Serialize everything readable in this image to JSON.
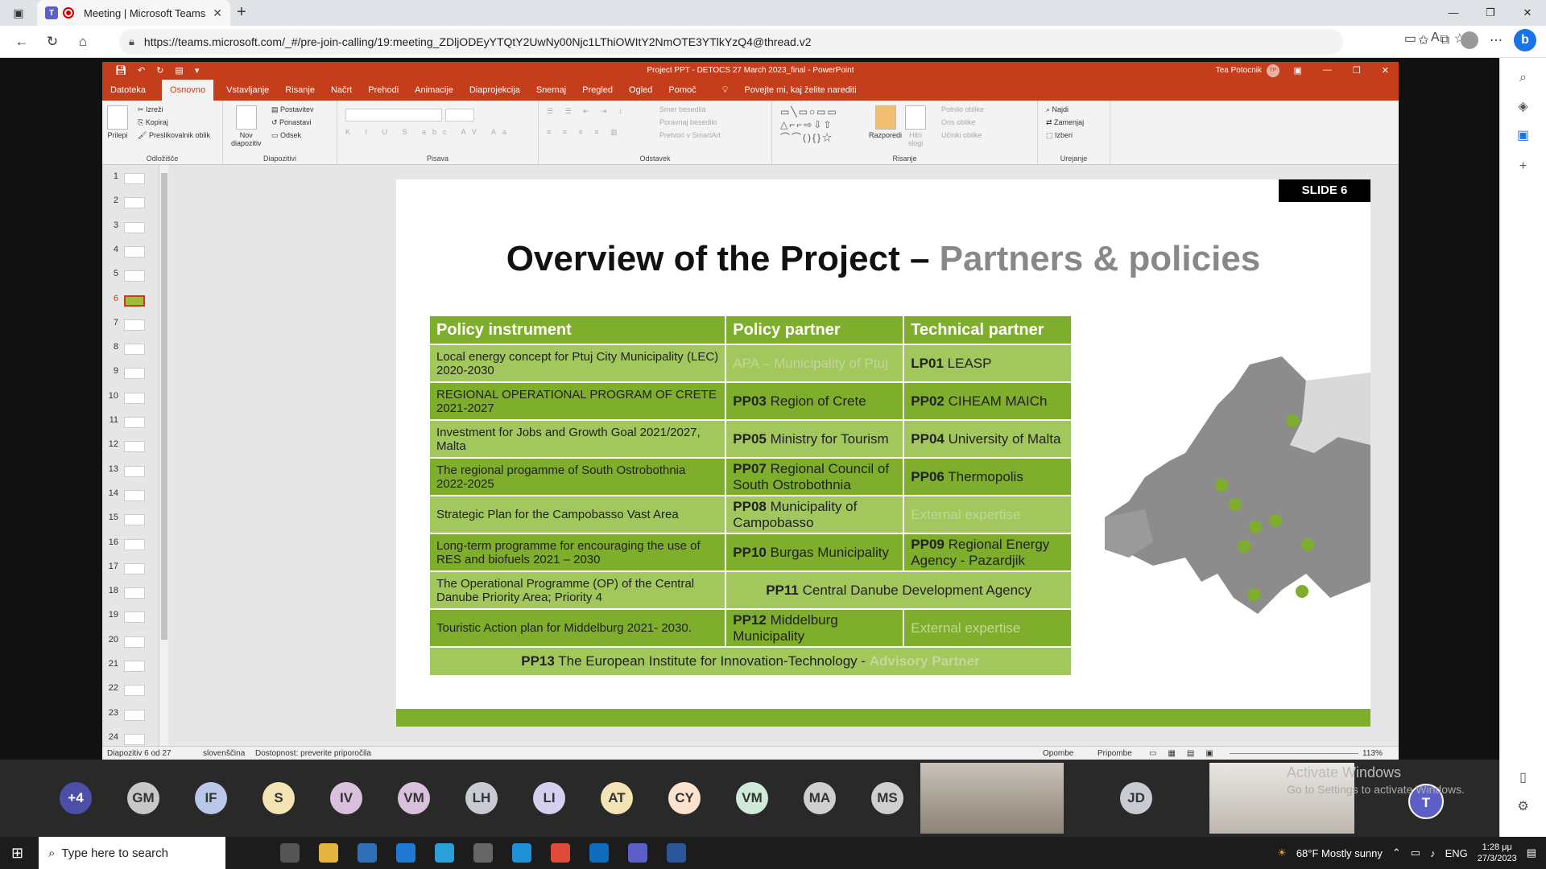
{
  "browser": {
    "tab_title": "Meeting | Microsoft Teams",
    "url": "https://teams.microsoft.com/_#/pre-join-calling/19:meeting_ZDljODEyYTQtY2UwNy00Njc1LThiOWItY2NmOTE3YTlkYzQ4@thread.v2"
  },
  "ppt": {
    "window_title": "Project PPT - DETOCS 27 March 2023_final  -  PowerPoint",
    "user_name": "Tea Potocnik",
    "user_initials": "TP",
    "tabs": [
      "Datoteka",
      "Osnovno",
      "Vstavljanje",
      "Risanje",
      "Načrt",
      "Prehodi",
      "Animacije",
      "Diaprojekcija",
      "Snemaj",
      "Pregled",
      "Ogled",
      "Pomoč"
    ],
    "active_tab": "Osnovno",
    "search": "Povejte mi, kaj želite narediti",
    "ribbon": {
      "paste": "Prilepi",
      "cut": "Izreži",
      "copy": "Kopiraj",
      "format_painter": "Preslikovalnik oblik",
      "clipboard": "Odložišče",
      "new_slide_1": "Nov",
      "new_slide_2": "diapozitiv",
      "layout": "Postavitev",
      "reset": "Ponastavi",
      "section": "Odsek",
      "slides": "Diapozitivi",
      "font": "Pisava",
      "text_direction": "Smer besedila",
      "align_text": "Poravnaj besedilo",
      "smartart": "Pretvori v SmartArt",
      "paragraph": "Odstavek",
      "arrange": "Razporedi",
      "quick_styles_1": "Hitri",
      "quick_styles_2": "slogi",
      "shape_fill": "Polnilo oblike",
      "shape_outline": "Oris oblike",
      "shape_effects": "Učinki oblike",
      "drawing": "Risanje",
      "find": "Najdi",
      "replace": "Zamenjaj",
      "select": "Izberi",
      "editing": "Urejanje"
    },
    "thumbnails": [
      "1",
      "2",
      "3",
      "4",
      "5",
      "6",
      "7",
      "8",
      "9",
      "10",
      "11",
      "12",
      "13",
      "14",
      "15",
      "16",
      "17",
      "18",
      "19",
      "20",
      "21",
      "22",
      "23",
      "24"
    ],
    "active_slide": "6",
    "status": {
      "slide": "Diapozitiv 6 od 27",
      "language": "slovenščina",
      "accessibility": "Dostopnost: preverite priporočila",
      "notes": "Opombe",
      "comments": "Pripombe",
      "zoom": "113%"
    }
  },
  "slide": {
    "tag": "SLIDE 6",
    "title_main": "Overview of the Project – ",
    "title_accent": "Partners & policies",
    "headers": [
      "Policy instrument",
      "Policy partner",
      "Technical partner"
    ],
    "rows": [
      {
        "instrument": "Local energy concept for Ptuj City Municipality (LEC) 2020-2030",
        "pcode": "",
        "pname": "APA – Municipality of Ptuj",
        "tcode": "LP01",
        "tname": "LEASP"
      },
      {
        "instrument": "REGIONAL OPERATIONAL PROGRAM OF CRETE 2021-2027",
        "pcode": "PP03",
        "pname": "Region of Crete",
        "tcode": "PP02",
        "tname": "CIHEAM MAICh"
      },
      {
        "instrument": "Investment for Jobs and Growth Goal 2021/2027, Malta",
        "pcode": "PP05",
        "pname": "Ministry for Tourism",
        "tcode": "PP04",
        "tname": "University of Malta"
      },
      {
        "instrument": "The regional progamme of South Ostrobothnia 2022-2025",
        "pcode": "PP07",
        "pname": "Regional Council of South Ostrobothnia",
        "tcode": "PP06",
        "tname": "Thermopolis"
      },
      {
        "instrument": "Strategic Plan for the Campobasso Vast Area",
        "pcode": "PP08",
        "pname": "Municipality of Campobasso",
        "tcode": "",
        "tname": "External expertise"
      },
      {
        "instrument": "Long-term programme for encouraging the use of RES and biofuels 2021 – 2030",
        "pcode": "PP10",
        "pname": "Burgas Municipality",
        "tcode": "PP09",
        "tname": "Regional Energy Agency - Pazardjik"
      },
      {
        "instrument": "The Operational Programme (OP) of the Central Danube Priority Area; Priority 4",
        "pcode": "PP11",
        "pname": "Central Danube Development Agency",
        "tcode": "",
        "tname": ""
      },
      {
        "instrument": "Touristic Action plan for Middelburg 2021- 2030.",
        "pcode": "PP12",
        "pname": "Middelburg Municipality",
        "tcode": "",
        "tname": "External expertise"
      }
    ],
    "last_code": "PP13",
    "last_name": "The European Institute for Innovation-Technology - ",
    "last_accent": "Advisory Partner"
  },
  "participants": [
    "+4",
    "GM",
    "IF",
    "S",
    "IV",
    "VM",
    "LH",
    "LI",
    "AT",
    "CY",
    "VM",
    "MA",
    "MS",
    "JD",
    "T"
  ],
  "participant_colors": [
    "#4b4fa8",
    "#c8c8c8",
    "#b9c7ea",
    "#f4e3b5",
    "#d9c0dc",
    "#d9c0dc",
    "#c8cbd2",
    "#d5cff0",
    "#f4e3b5",
    "#fbe3cf",
    "#cfead9",
    "#cfcfcf",
    "#cfcfcf",
    "#c8cbd2",
    "#5b5fc7"
  ],
  "watermark": {
    "title": "Activate Windows",
    "sub": "Go to Settings to activate Windows."
  },
  "taskbar": {
    "search": "Type here to search",
    "weather": "68°F  Mostly sunny",
    "lang": "ENG",
    "time": "1:28 μμ",
    "date": "27/3/2023"
  }
}
